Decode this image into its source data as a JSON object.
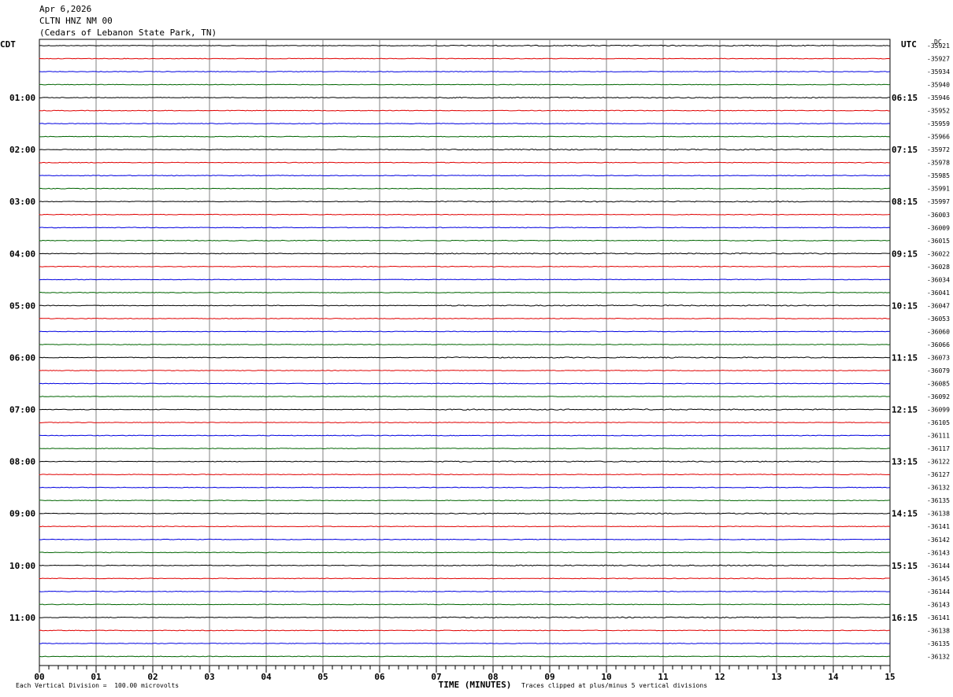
{
  "header": {
    "date": "Apr 6,2026",
    "station": "CLTN HNZ NM 00",
    "location": "(Cedars of Lebanon State Park, TN)"
  },
  "axes": {
    "left_timezone": "CDT",
    "right_timezone": "UTC",
    "dc_label": "DC",
    "xlabel": "TIME (MINUTES)"
  },
  "footer": {
    "left_note": "Each Vertical Division =  100.00 microvolts",
    "right_note": "Traces clipped at plus/minus 5 vertical divisions"
  },
  "colors": {
    "trace_cycle": [
      "#000000",
      "#e00000",
      "#0000e0",
      "#006400"
    ],
    "grid": "#808080"
  },
  "chart_data": {
    "type": "line",
    "title": "",
    "xlabel": "TIME (MINUTES)",
    "ylabel": "",
    "x_ticks": [
      "00",
      "01",
      "02",
      "03",
      "04",
      "05",
      "06",
      "07",
      "08",
      "09",
      "10",
      "11",
      "12",
      "13",
      "14",
      "15"
    ],
    "xlim": [
      0,
      15
    ],
    "rows_per_hour": 4,
    "trace_count": 48,
    "left_hour_labels": [
      "01:00",
      "02:00",
      "03:00",
      "04:00",
      "05:00",
      "06:00",
      "07:00",
      "08:00",
      "09:00",
      "10:00",
      "11:00"
    ],
    "right_hour_labels": [
      "06:15",
      "07:15",
      "08:15",
      "09:15",
      "10:15",
      "11:15",
      "12:15",
      "13:15",
      "14:15",
      "15:15",
      "16:15"
    ],
    "dc_offsets": [
      "-35921",
      "-35927",
      "-35934",
      "-35940",
      "-35946",
      "-35952",
      "-35959",
      "-35966",
      "-35972",
      "-35978",
      "-35985",
      "-35991",
      "-35997",
      "-36003",
      "-36009",
      "-36015",
      "-36022",
      "-36028",
      "-36034",
      "-36041",
      "-36047",
      "-36053",
      "-36060",
      "-36066",
      "-36073",
      "-36079",
      "-36085",
      "-36092",
      "-36099",
      "-36105",
      "-36111",
      "-36117",
      "-36122",
      "-36127",
      "-36132",
      "-36135",
      "-36138",
      "-36141",
      "-36142",
      "-36143",
      "-36144",
      "-36145",
      "-36144",
      "-36143",
      "-36141",
      "-36138",
      "-36135",
      "-36132"
    ],
    "grid": true
  }
}
